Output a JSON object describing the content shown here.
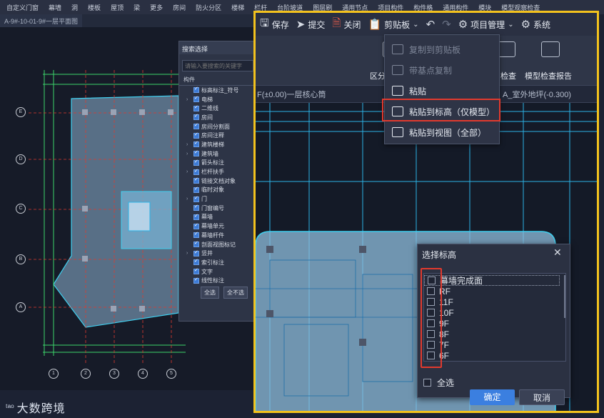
{
  "bg_menu": [
    "自定义门窗",
    "幕墙",
    "洞",
    "楼板",
    "屋顶",
    "梁",
    "更多",
    "房间",
    "防火分区",
    "楼梯",
    "栏杆",
    "台阶坡道",
    "图层刷",
    "通用节点",
    "项目构件",
    "构件格",
    "通用构件",
    "模块",
    "模型观察检查"
  ],
  "bg_tab": "A-9#-10-01-9#一层平面图",
  "search_panel": {
    "title": "搜索选择",
    "placeholder": "请输入要搜索的关键字",
    "list_header": "构件",
    "items": [
      {
        "label": "标高标注_符号",
        "caret": ""
      },
      {
        "label": "电梯",
        "caret": "›"
      },
      {
        "label": "二维线",
        "caret": ""
      },
      {
        "label": "房间",
        "caret": ""
      },
      {
        "label": "房间分割面",
        "caret": ""
      },
      {
        "label": "房间注释",
        "caret": ""
      },
      {
        "label": "建筑楼梯",
        "caret": "›"
      },
      {
        "label": "建筑墙",
        "caret": "›"
      },
      {
        "label": "箭头标注",
        "caret": ""
      },
      {
        "label": "栏杆扶手",
        "caret": "›"
      },
      {
        "label": "链接文档对象",
        "caret": ""
      },
      {
        "label": "临时对象",
        "caret": ""
      },
      {
        "label": "门",
        "caret": "›"
      },
      {
        "label": "门窗编号",
        "caret": ""
      },
      {
        "label": "幕墙",
        "caret": ""
      },
      {
        "label": "幕墙单元",
        "caret": ""
      },
      {
        "label": "幕墙杆件",
        "caret": ""
      },
      {
        "label": "剖面视图标记",
        "caret": ""
      },
      {
        "label": "竖井",
        "caret": "›"
      },
      {
        "label": "索引标注",
        "caret": ""
      },
      {
        "label": "文字",
        "caret": ""
      },
      {
        "label": "线性标注",
        "caret": ""
      }
    ],
    "select_all": "全选",
    "select_none": "全不选"
  },
  "watermark": "大数跨境",
  "toolbar": {
    "save": "保存",
    "submit": "提交",
    "close": "关闭",
    "clipboard": "剪贴板",
    "project_mgmt": "项目管理",
    "system": "系统"
  },
  "ribbon": {
    "partition": "区分",
    "check": "检查",
    "model_check_report": "模型检查报告"
  },
  "view_tabs": {
    "left": "F(±0.00)一层核心筒",
    "right": "A_室外地坪(-0.300)"
  },
  "clipboard_menu": {
    "items": [
      {
        "label": "复制到剪贴板",
        "disabled": true
      },
      {
        "label": "带基点复制",
        "disabled": true
      },
      {
        "label": "粘贴",
        "disabled": false
      },
      {
        "label": "粘贴到标高（仅模型）",
        "disabled": false
      },
      {
        "label": "粘贴到视图（全部）",
        "disabled": false
      }
    ]
  },
  "elevation_dialog": {
    "title": "选择标高",
    "items": [
      "幕墙完成面",
      "RF",
      "11F",
      "10F",
      "9F",
      "8F",
      "7F",
      "6F"
    ],
    "select_all": "全选",
    "ok": "确定",
    "cancel": "取消"
  },
  "colors": {
    "highlight_border": "#f3c21d",
    "annotation_red": "#e23a2e",
    "primary_button": "#3b7fe0",
    "cad_cyan": "#2bb3e6"
  }
}
